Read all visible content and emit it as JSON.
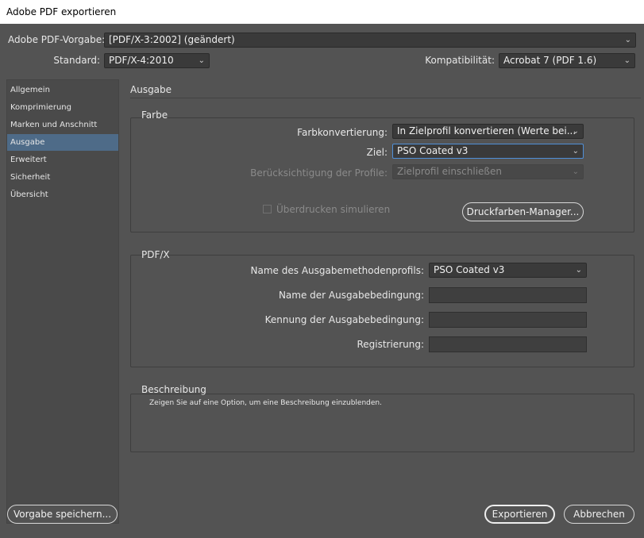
{
  "window": {
    "title": "Adobe PDF exportieren"
  },
  "top": {
    "preset_label": "Adobe PDF-Vorgabe:",
    "preset_value": "[PDF/X-3:2002] (geändert)",
    "standard_label": "Standard:",
    "standard_value": "PDF/X-4:2010",
    "compat_label": "Kompatibilität:",
    "compat_value": "Acrobat 7 (PDF 1.6)"
  },
  "sidebar": {
    "items": [
      {
        "label": "Allgemein"
      },
      {
        "label": "Komprimierung"
      },
      {
        "label": "Marken und Anschnitt"
      },
      {
        "label": "Ausgabe"
      },
      {
        "label": "Erweitert"
      },
      {
        "label": "Sicherheit"
      },
      {
        "label": "Übersicht"
      }
    ],
    "active": "Ausgabe"
  },
  "main": {
    "section_title": "Ausgabe",
    "farbe": {
      "title": "Farbe",
      "conversion_label": "Farbkonvertierung:",
      "conversion_value": "In Zielprofil konvertieren (Werte bei...",
      "target_label": "Ziel:",
      "target_value": "PSO Coated v3",
      "profile_label": "Berücksichtigung der Profile:",
      "profile_value": "Zielprofil einschließen",
      "overprint_label": "Überdrucken simulieren",
      "ink_manager_button": "Druckfarben-Manager..."
    },
    "pdfx": {
      "title": "PDF/X",
      "output_profile_label": "Name des Ausgabemethodenprofils:",
      "output_profile_value": "PSO Coated v3",
      "condition_name_label": "Name der Ausgabebedingung:",
      "condition_name_value": "",
      "condition_id_label": "Kennung der Ausgabebedingung:",
      "condition_id_value": "",
      "registry_label": "Registrierung:",
      "registry_value": ""
    },
    "description": {
      "title": "Beschreibung",
      "text": "Zeigen Sie auf eine Option, um eine Beschreibung einzublenden."
    }
  },
  "footer": {
    "save_preset": "Vorgabe speichern...",
    "export": "Exportieren",
    "cancel": "Abbrechen"
  },
  "icons": {
    "dropdown": "chevron-down-icon"
  }
}
